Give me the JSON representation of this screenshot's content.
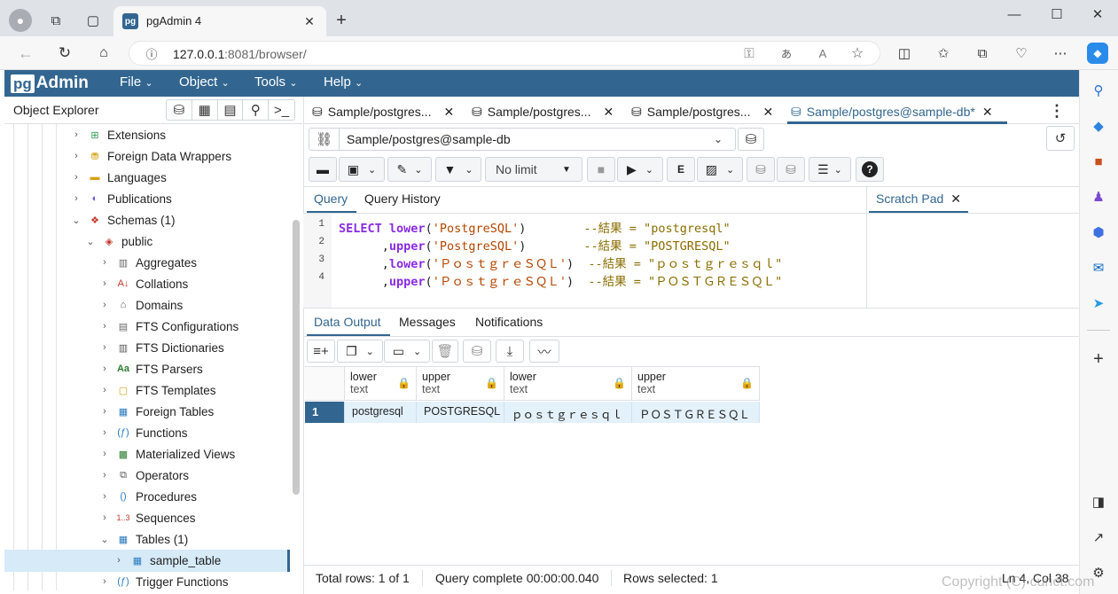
{
  "browser": {
    "tab_title": "pgAdmin 4",
    "url_host": "127.0.0.1",
    "url_rest": ":8081/browser/"
  },
  "pgadmin": {
    "logo_pg": "pg",
    "logo_admin": "Admin",
    "menu": [
      "File",
      "Object",
      "Tools",
      "Help"
    ],
    "object_explorer_title": "Object Explorer"
  },
  "tree": [
    {
      "label": "Extensions",
      "icon": "extensions-icon"
    },
    {
      "label": "Foreign Data Wrappers",
      "icon": "fdw-icon"
    },
    {
      "label": "Languages",
      "icon": "languages-icon"
    },
    {
      "label": "Publications",
      "icon": "publications-icon"
    },
    {
      "label": "Schemas (1)",
      "icon": "schemas-icon"
    },
    {
      "label": "public",
      "icon": "schema-icon"
    },
    {
      "label": "Aggregates",
      "icon": "aggregates-icon"
    },
    {
      "label": "Collations",
      "icon": "collations-icon"
    },
    {
      "label": "Domains",
      "icon": "domains-icon"
    },
    {
      "label": "FTS Configurations",
      "icon": "fts-config-icon"
    },
    {
      "label": "FTS Dictionaries",
      "icon": "fts-dict-icon"
    },
    {
      "label": "FTS Parsers",
      "icon": "fts-parser-icon"
    },
    {
      "label": "FTS Templates",
      "icon": "fts-template-icon"
    },
    {
      "label": "Foreign Tables",
      "icon": "foreign-tables-icon"
    },
    {
      "label": "Functions",
      "icon": "functions-icon"
    },
    {
      "label": "Materialized Views",
      "icon": "mat-views-icon"
    },
    {
      "label": "Operators",
      "icon": "operators-icon"
    },
    {
      "label": "Procedures",
      "icon": "procedures-icon"
    },
    {
      "label": "Sequences",
      "icon": "sequences-icon"
    },
    {
      "label": "Tables (1)",
      "icon": "tables-icon"
    },
    {
      "label": "sample_table",
      "icon": "table-icon"
    },
    {
      "label": "Trigger Functions",
      "icon": "trigger-functions-icon"
    }
  ],
  "query_tabs": [
    "Sample/postgres...",
    "Sample/postgres...",
    "Sample/postgres...",
    "Sample/postgres@sample-db*"
  ],
  "connection": "Sample/postgres@sample-db",
  "toolbar": {
    "limit": "No limit"
  },
  "editor_tabs": {
    "query": "Query",
    "history": "Query History",
    "scratch": "Scratch Pad"
  },
  "code": {
    "line_numbers": [
      "1",
      "2",
      "3",
      "4"
    ],
    "l1": {
      "kw": "SELECT",
      "fn": "lower",
      "open": "(",
      "str": "'PostgreSQL'",
      "close": ")",
      "pad": "        ",
      "cm": "--結果 = \"postgresql\""
    },
    "l2": {
      "lead": "      ,",
      "fn": "upper",
      "open": "(",
      "str": "'PostgreSQL'",
      "close": ")",
      "pad": "        ",
      "cm": "--結果 = \"POSTGRESQL\""
    },
    "l3": {
      "lead": "      ,",
      "fn": "lower",
      "open": "(",
      "str": "'ＰｏｓｔｇｒｅＳＱＬ'",
      "close": ")",
      "pad": "  ",
      "cm": "--結果 = \"ｐｏｓｔｇｒｅｓｑｌ\""
    },
    "l4": {
      "lead": "      ,",
      "fn": "upper",
      "open": "(",
      "str": "'ＰｏｓｔｇｒｅＳＱＬ'",
      "close": ")",
      "pad": "  ",
      "cm": "--結果 = \"ＰＯＳＴＧＲＥＳＱＬ\""
    }
  },
  "output_tabs": [
    "Data Output",
    "Messages",
    "Notifications"
  ],
  "grid": {
    "columns": [
      {
        "name": "lower",
        "type": "text"
      },
      {
        "name": "upper",
        "type": "text"
      },
      {
        "name": "lower",
        "type": "text"
      },
      {
        "name": "upper",
        "type": "text"
      }
    ],
    "row_number": "1",
    "row": [
      "postgresql",
      "POSTGRESQL",
      "ｐｏｓｔｇｒｅｓｑｌ",
      "ＰＯＳＴＧＲＥＳＱＬ"
    ]
  },
  "status": {
    "total_rows": "Total rows: 1 of 1",
    "query_complete": "Query complete 00:00:00.040",
    "rows_selected": "Rows selected: 1",
    "cursor": "Ln 4, Col 38"
  },
  "watermark": "Copyright (C) curict.com"
}
